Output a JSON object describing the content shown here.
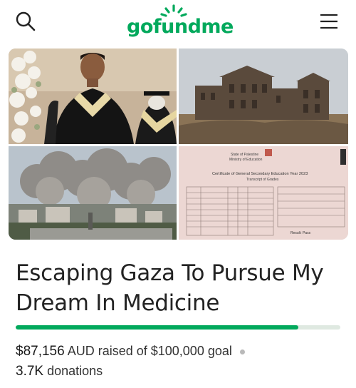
{
  "header": {
    "logo_text": "gofundme",
    "brand_color": "#02a95c",
    "icons": [
      "search-icon",
      "hamburger-menu-icon"
    ]
  },
  "hero": {
    "panels": [
      "graduation-photo",
      "ruined-building-photo",
      "smoke-over-city-photo",
      "education-certificate-photo"
    ],
    "certificate": {
      "line1": "State of Palestine",
      "line2": "Ministry of Education",
      "title": "Certificate of General Secondary Education Year 2023",
      "subtitle": "Transcript of Grades",
      "result_label": "Result: Pass"
    }
  },
  "campaign": {
    "title": "Escaping Gaza To Pursue My Dream In Medicine",
    "amount_raised": "$87,156",
    "raised_text": "AUD raised of $100,000 goal",
    "progress_fraction": 0.87156,
    "donations_count": "3.7K",
    "donations_label": "donations"
  }
}
